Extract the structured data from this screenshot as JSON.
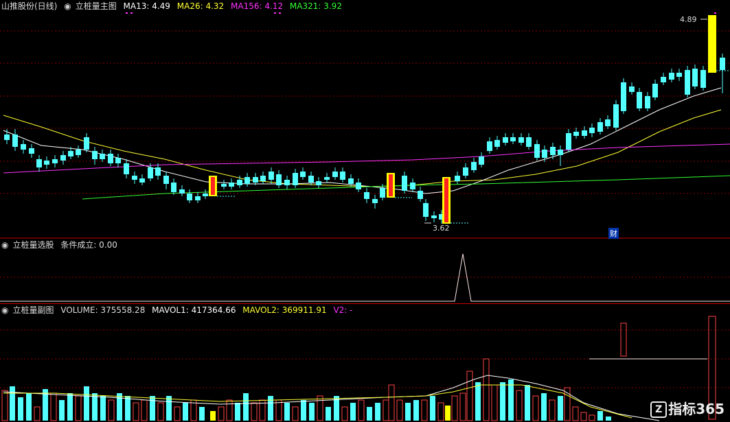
{
  "main_panel": {
    "title": "山推股份(日线)",
    "indicator_name": "立桩量主图",
    "ma13": "MA13: 4.49",
    "ma26": "MA26: 4.32",
    "ma156": "MA156: 4.12",
    "ma321": "MA321: 3.92",
    "high_label": "4.89",
    "low_label": "3.62",
    "fin_marker": "财",
    "colors": {
      "ma13": "#ffffff",
      "ma26": "#ffff33",
      "ma156": "#ff33ff",
      "ma321": "#33ff33",
      "up": "#ff3333",
      "down": "#54ffff",
      "pile": "#ffff00"
    }
  },
  "select_panel": {
    "indicator_name": "立桩量选股",
    "condition": "条件成立: 0.00"
  },
  "volume_panel": {
    "indicator_name": "立桩量副图",
    "volume": "VOLUME: 375558.28",
    "mavol1": "MAVOL1: 417364.66",
    "mavol2": "MAVOL2: 369911.91",
    "v2": "V2: -"
  },
  "watermark": {
    "text": "指标365",
    "logo_icon": "zhibiao365-logo-icon"
  }
}
